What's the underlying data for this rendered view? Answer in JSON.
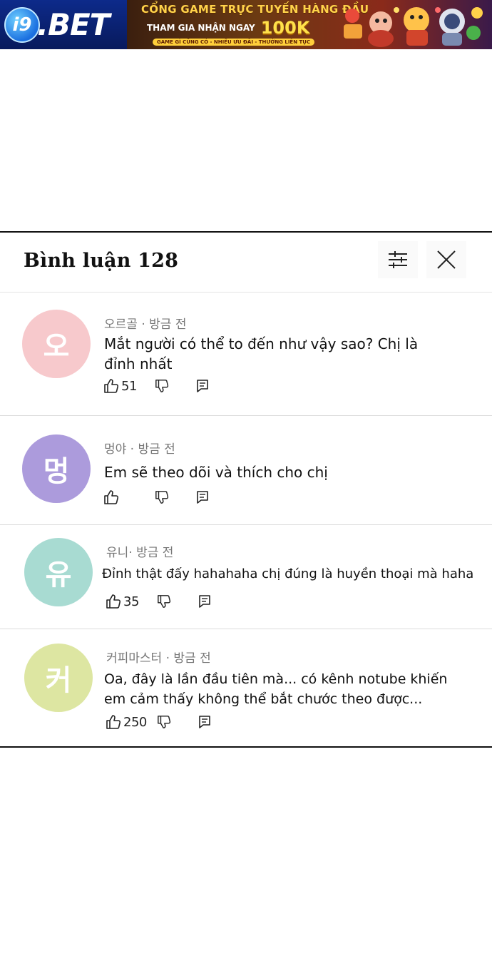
{
  "banner": {
    "brand": "i9.BET",
    "logo_mark": "i9",
    "logo_word": ".BET",
    "headline": "CỔNG GAME TRỰC TUYẾN HÀNG ĐẦU",
    "offer_text": "THAM GIA NHẬN NGAY",
    "offer_amount": "100K",
    "tagline": "GAME GÌ CŨNG CÓ - NHIỀU ƯU ĐÃI - THƯỞNG LIÊN TỤC"
  },
  "comments_panel": {
    "title": "Bình luận 128",
    "filter_icon": "sliders-icon",
    "close_icon": "close-icon",
    "comments": [
      {
        "avatar_char": "오",
        "avatar_color": "#f7c9cc",
        "meta": "오르골 · 방금 전",
        "body_line1": "Mắt người có thể to đến như vậy sao? Chị là",
        "body_line2": "đỉnh nhất",
        "likes": "51"
      },
      {
        "avatar_char": "멍",
        "avatar_color": "#ac9bdc",
        "meta": "멍야 · 방금 전",
        "body_line1": "Em sẽ theo dõi và thích cho chị",
        "body_line2": "",
        "likes": ""
      },
      {
        "avatar_char": "유",
        "avatar_color": "#a8dbd2",
        "meta": "유니· 방금 전",
        "body_line1": "Đỉnh thật đấy hahahaha chị đúng là huyền thoại mà haha",
        "body_line2": "",
        "likes": "35"
      },
      {
        "avatar_char": "커",
        "avatar_color": "#dde6a2",
        "meta": "커피마스터 · 방금 전",
        "body_line1": "Oa, đây là lần đầu tiên mà... có kênh notube khiến",
        "body_line2": "em cảm thấy không thể bắt chước theo được...",
        "likes": "250"
      }
    ]
  }
}
